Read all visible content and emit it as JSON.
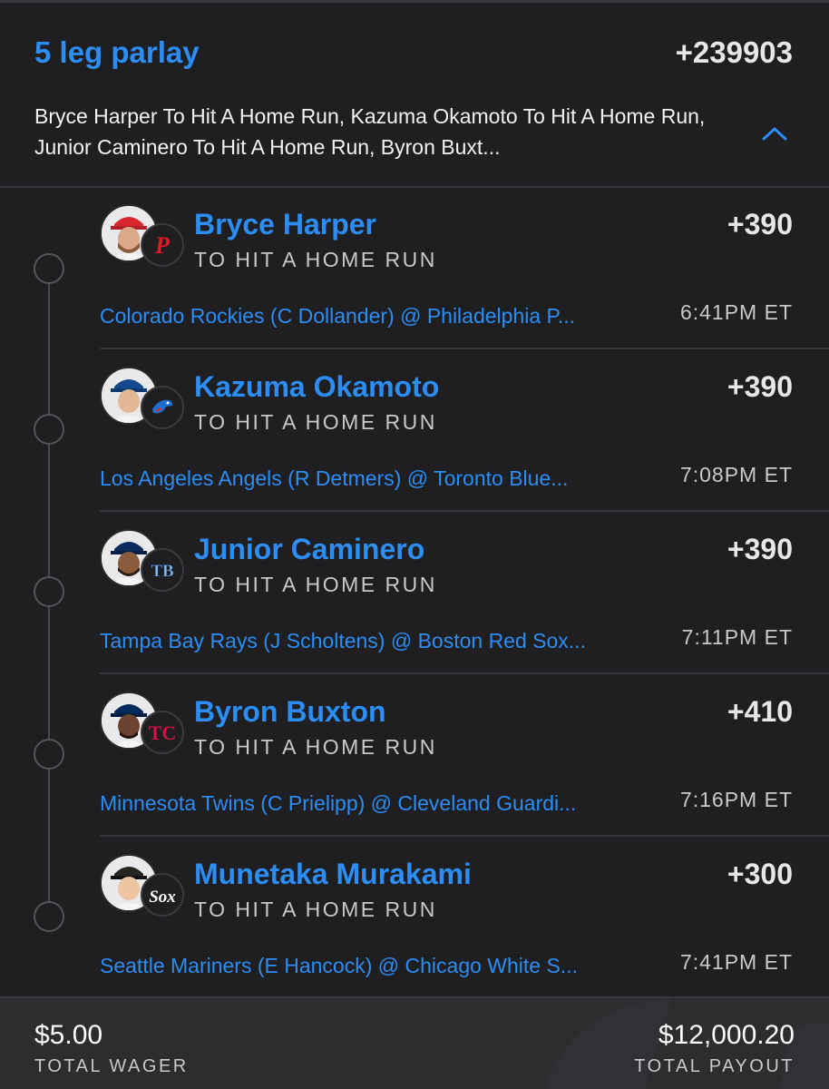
{
  "colors": {
    "accent": "#2c8df5",
    "background": "#1f1f21",
    "footer_background": "#2d2d30",
    "text_primary": "#ffffff",
    "text_secondary": "#c9c9cc"
  },
  "parlay": {
    "title": "5 leg parlay",
    "odds": "+239903",
    "description": "Bryce Harper To Hit A Home Run, Kazuma Okamoto To Hit A Home Run, Junior Caminero To Hit A Home Run, Byron Buxt...",
    "collapse_icon": "chevron-up-icon"
  },
  "legs": [
    {
      "player": "Bryce Harper",
      "odds": "+390",
      "market": "TO HIT A HOME RUN",
      "matchup": "Colorado Rockies (C Dollander) @ Philadelphia P...",
      "time": "6:41PM ET",
      "team_icon": "phillies-logo-icon"
    },
    {
      "player": "Kazuma Okamoto",
      "odds": "+390",
      "market": "TO HIT A HOME RUN",
      "matchup": "Los Angeles Angels (R Detmers) @ Toronto Blue...",
      "time": "7:08PM ET",
      "team_icon": "blue-jays-logo-icon"
    },
    {
      "player": "Junior Caminero",
      "odds": "+390",
      "market": "TO HIT A HOME RUN",
      "matchup": "Tampa Bay Rays (J Scholtens) @ Boston Red Sox...",
      "time": "7:11PM ET",
      "team_icon": "rays-logo-icon"
    },
    {
      "player": "Byron Buxton",
      "odds": "+410",
      "market": "TO HIT A HOME RUN",
      "matchup": "Minnesota Twins (C Prielipp) @ Cleveland Guardi...",
      "time": "7:16PM ET",
      "team_icon": "twins-logo-icon"
    },
    {
      "player": "Munetaka Murakami",
      "odds": "+300",
      "market": "TO HIT A HOME RUN",
      "matchup": "Seattle Mariners (E Hancock) @ Chicago White S...",
      "time": "7:41PM ET",
      "team_icon": "white-sox-logo-icon"
    }
  ],
  "footer": {
    "wager_amount": "$5.00",
    "wager_label": "TOTAL WAGER",
    "payout_amount": "$12,000.20",
    "payout_label": "TOTAL PAYOUT"
  }
}
